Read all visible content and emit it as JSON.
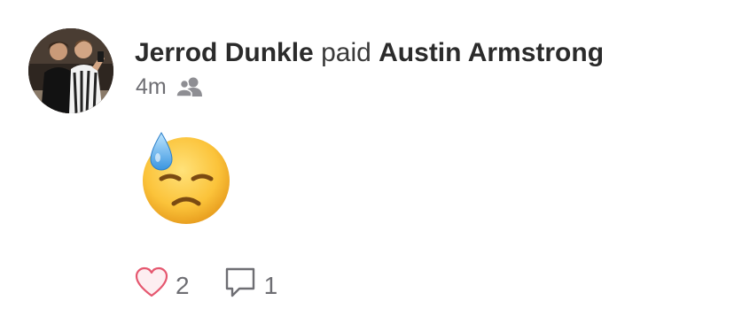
{
  "story": {
    "actor_name": "Jerrod Dunkle",
    "verb": "paid",
    "target_name": "Austin Armstrong",
    "timestamp": "4m",
    "audience_icon": "friends-icon",
    "note_emoji": "downcast-face-with-sweat-emoji"
  },
  "actions": {
    "like_icon": "heart-outline-icon",
    "like_count": "2",
    "comment_icon": "speech-bubble-outline-icon",
    "comment_count": "1"
  },
  "colors": {
    "heart_stroke": "#e5576f",
    "heart_fill": "#fdeef1",
    "name_text": "#2b2b2b",
    "muted_text": "#6e6e73"
  }
}
